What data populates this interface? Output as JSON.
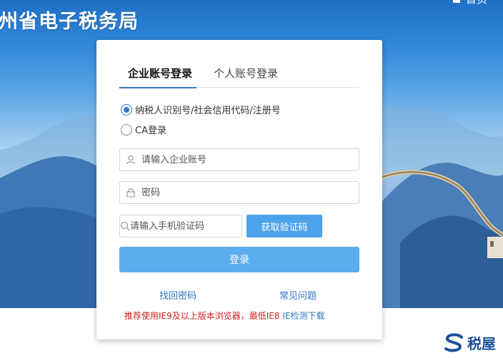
{
  "header": {
    "site_title": "州省电子税务局",
    "home_label": "首页"
  },
  "login": {
    "tabs": [
      {
        "label": "企业账号登录",
        "active": true
      },
      {
        "label": "个人账号登录",
        "active": false
      }
    ],
    "radio_options": [
      {
        "label": "纳税人识别号/社会信用代码/注册号",
        "checked": true
      },
      {
        "label": "CA登录",
        "checked": false
      }
    ],
    "account_placeholder": "请输入企业账号",
    "password_placeholder": "密码",
    "sms_placeholder": "请输入手机验证码",
    "get_code_label": "获取验证码",
    "submit_label": "登录",
    "forgot_password": "找回密码",
    "faq": "常见问题",
    "browser_notice": "推荐使用IE9及以上版本浏览器，最低IE8",
    "ie_check_link": "IE检测下载"
  },
  "footer": {
    "brand_text": "税屋"
  },
  "colors": {
    "accent": "#2a7ad0",
    "button": "#5aaeee",
    "link": "#2e78c5",
    "notice": "#cc2222"
  },
  "icons": [
    "home-icon",
    "user-icon",
    "lock-icon",
    "search-icon",
    "brand-logo-icon"
  ]
}
